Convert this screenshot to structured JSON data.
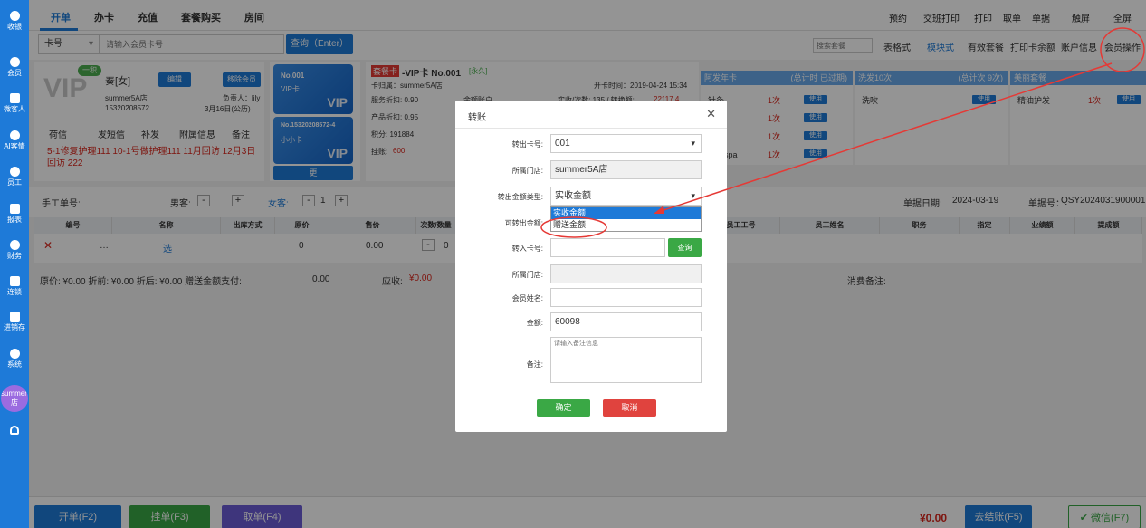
{
  "sidebar": {
    "items": [
      "收银",
      "会员",
      "微客人",
      "AI客情",
      "员工",
      "报表",
      "财务",
      "连锁",
      "进销存",
      "系统"
    ],
    "store": "summer5A店"
  },
  "topbar": {
    "tabs": [
      "开单",
      "办卡",
      "充值",
      "套餐购买",
      "房间"
    ],
    "right": [
      "预约",
      "交班打印",
      "打印",
      "取单",
      "单据",
      "触屏",
      "全屏"
    ]
  },
  "search": {
    "type": "卡号",
    "placeholder": "请输入会员卡号",
    "button": "查询（Enter）",
    "pkg_placeholder": "搜索套餐",
    "links": [
      "表格式",
      "模块式",
      "有效套餐",
      "打印卡余额",
      "账户信息",
      "会员操作"
    ]
  },
  "member": {
    "level": "一积",
    "name": "秦[女]",
    "edit": "编辑",
    "remove": "移除会员",
    "store": "summer5A店",
    "owner": "负责人：lily",
    "phone": "15320208572",
    "birthday": "3月16日(公历)",
    "actions": [
      "荷信",
      "发短信",
      "补发",
      "附属信息",
      "备注"
    ],
    "notes": "5-1修复护理111  10-1号做护理111  11月回访  12月3日回访  222"
  },
  "cards": [
    {
      "no": "No.001",
      "type": "VIP卡",
      "brand": "VIP"
    },
    {
      "no": "No.15320208572-4",
      "type": "小小卡",
      "brand": "VIP"
    }
  ],
  "more": "更",
  "cardinfo": {
    "tag": "套餐卡",
    "title": "-VIP卡 No.001",
    "forever": "[永久]",
    "belong": "卡归属：summer5A店",
    "open": "开卡时间：2019-04-24 15:34",
    "service": "服务折扣: 0.90",
    "product": "产品折扣: 0.95",
    "points": "积分: 191884",
    "debt_label": "挂账:",
    "debt": "600",
    "balance_frag": "余额账户",
    "real_frag": "实收/次数: 135 / 转换额:",
    "real_val": "22117.4"
  },
  "packages": {
    "sections": [
      {
        "title": "阿发年卡",
        "sub": "(总计时 已过期)"
      },
      {
        "title": "洗发10次",
        "sub": "(总计次 9次)"
      },
      {
        "title": "美丽套餐",
        "sub": ""
      }
    ],
    "items1": [
      {
        "name": "针灸",
        "count": "1次"
      },
      {
        "name": "烫额",
        "count": "1次"
      },
      {
        "name": "针灸",
        "count": "1次"
      },
      {
        "name": "美容spa",
        "count": "1次"
      }
    ],
    "items2": [
      {
        "name": "洗吹"
      }
    ],
    "items3": [
      {
        "name": "精油护发",
        "count": "1次"
      }
    ],
    "use": "使用"
  },
  "order": {
    "manual_label": "手工单号:",
    "male": "男客:",
    "female": "女客:",
    "female_count": "1",
    "date_label": "单据日期:",
    "date": "2024-03-19",
    "no_label": "单据号：",
    "no": "QSY2024031900001"
  },
  "table": {
    "headers": [
      "编号",
      "名称",
      "出库方式",
      "原价",
      "售价",
      "次数/数量",
      "",
      "员工工号",
      "员工姓名",
      "职务",
      "指定",
      "业绩额",
      "提成额"
    ],
    "row": {
      "name": "选",
      "orig": "0",
      "price": "0.00",
      "qty": "0"
    }
  },
  "totals": {
    "text": "原价: ¥0.00  折前: ¥0.00  折后: ¥0.00  赠送金额支付:",
    "gift": "0.00",
    "due_label": "应收:",
    "due": "¥0.00",
    "remark": "消费备注:"
  },
  "bottom": {
    "open": "开单(F2)",
    "hang": "挂单(F3)",
    "take": "取单(F4)",
    "amount": "¥0.00",
    "checkout": "去结账(F5)",
    "wechat": "微信(F7)"
  },
  "modal": {
    "title": "转账",
    "fields": {
      "out_card_label": "转出卡号:",
      "out_card": "001",
      "store_label": "所属门店:",
      "store": "summer5A店",
      "type_label": "转出金额类型:",
      "type": "实收金额",
      "avail_label": "可转出金额:",
      "in_card_label": "转入卡号:",
      "query": "查询",
      "in_store_label": "所属门店:",
      "name_label": "会员姓名:",
      "amount_label": "金额:",
      "amount": "60098",
      "remark_label": "备注:",
      "remark_placeholder": "请输入备注信息"
    },
    "options": [
      "实收金额",
      "赠送金额"
    ],
    "ok": "确定",
    "cancel": "取消"
  }
}
